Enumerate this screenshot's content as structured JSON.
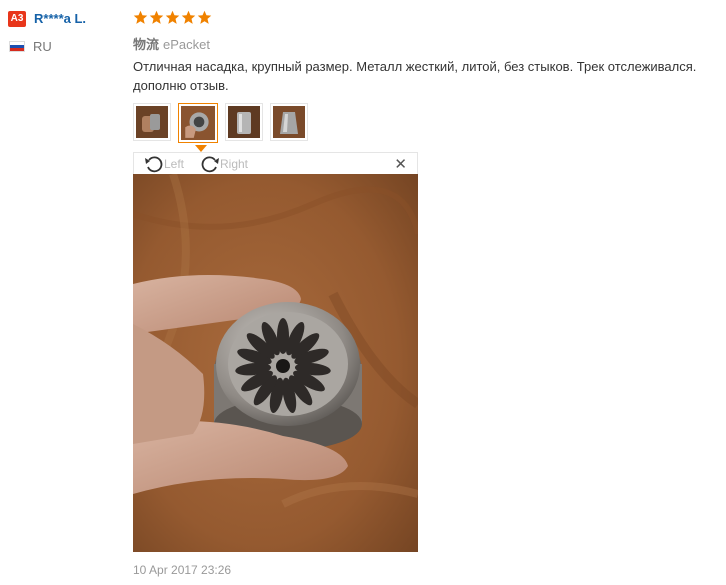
{
  "reviewer": {
    "badge": "A3",
    "name": "R****a L.",
    "country": "RU"
  },
  "rating": {
    "stars": 5,
    "max": 5,
    "color": "#f08200"
  },
  "shipping": {
    "label": "物流",
    "method": "ePacket"
  },
  "review_text": "Отличная насадка, крупный размер. Металл жесткий, литой, без стыков. Трек отслеживался. дополню отзыв.",
  "thumbnails": [
    {
      "name": "photo-1",
      "active": false
    },
    {
      "name": "photo-2",
      "active": true
    },
    {
      "name": "photo-3",
      "active": false
    },
    {
      "name": "photo-4",
      "active": false
    }
  ],
  "viewer": {
    "rotate_left_label": "Left",
    "rotate_right_label": "Right",
    "close_icon": "close-icon"
  },
  "date": "10 Apr 2017 23:26"
}
